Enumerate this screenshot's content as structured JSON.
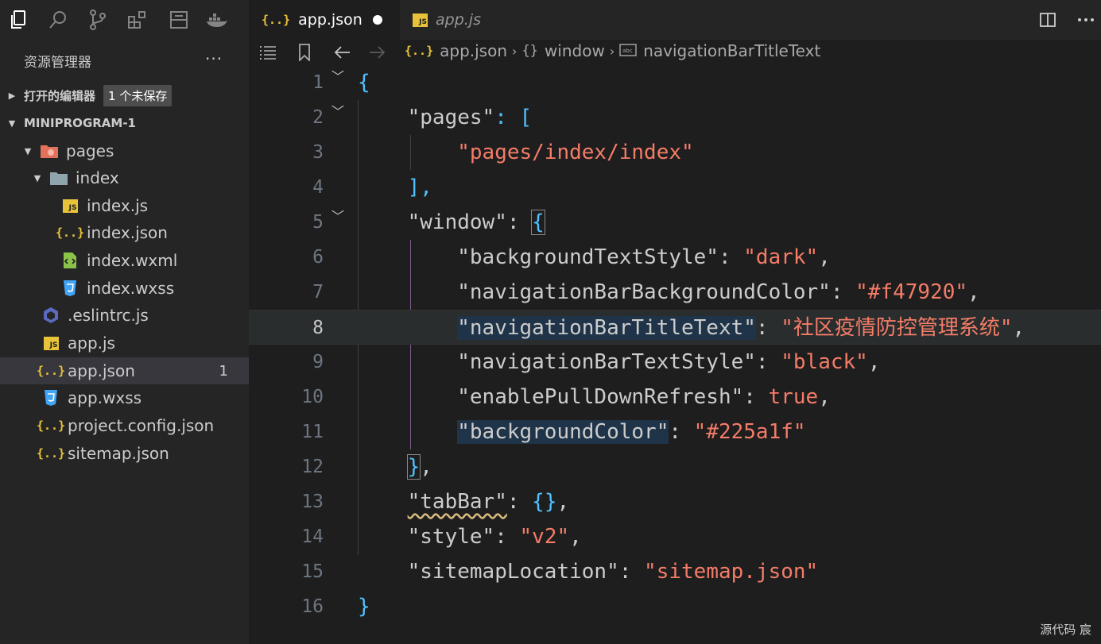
{
  "tabs": [
    {
      "label": "app.json",
      "icon": "json-icon",
      "active": true,
      "unsaved": true
    },
    {
      "label": "app.js",
      "icon": "js-icon",
      "active": false
    }
  ],
  "sidebar": {
    "title": "资源管理器",
    "more": "···",
    "sections": {
      "open_editors": {
        "label": "打开的编辑器",
        "badge": "1 个未保存"
      },
      "project": {
        "label": "MINIPROGRAM-1"
      }
    },
    "tree": [
      {
        "label": "pages",
        "icon": "folder-pages-icon"
      },
      {
        "label": "index",
        "icon": "folder-icon"
      },
      {
        "label": "index.js",
        "icon": "js-icon"
      },
      {
        "label": "index.json",
        "icon": "json-icon"
      },
      {
        "label": "index.wxml",
        "icon": "wxml-icon"
      },
      {
        "label": "index.wxss",
        "icon": "css-icon"
      },
      {
        "label": ".eslintrc.js",
        "icon": "eslint-icon"
      },
      {
        "label": "app.js",
        "icon": "js-icon"
      },
      {
        "label": "app.json",
        "icon": "json-icon",
        "count": "1",
        "selected": true
      },
      {
        "label": "app.wxss",
        "icon": "css-icon"
      },
      {
        "label": "project.config.json",
        "icon": "json-icon"
      },
      {
        "label": "sitemap.json",
        "icon": "json-icon"
      }
    ]
  },
  "breadcrumb": {
    "file": "app.json",
    "obj": "window",
    "prop": "navigationBarTitleText"
  },
  "json_icon_text": "{..}",
  "js_icon_text": "JS",
  "editor": {
    "line_numbers": [
      "1",
      "2",
      "3",
      "4",
      "5",
      "6",
      "7",
      "8",
      "9",
      "10",
      "11",
      "12",
      "13",
      "14",
      "15",
      "16"
    ],
    "lines": {
      "l1": "{",
      "l2_key": "\"pages\"",
      "l2_rest": ": [",
      "l3_val": "\"pages/index/index\"",
      "l4": "],",
      "l5_key": "\"window\"",
      "l5_colon": ": ",
      "l5_brace": "{",
      "l6_key": "\"backgroundTextStyle\"",
      "l6_val": "\"dark\"",
      "l7_key": "\"navigationBarBackgroundColor\"",
      "l7_val": "\"#f47920\"",
      "l8_key": "\"navigationBarTitleText\"",
      "l8_val": "\"社区疫情防控管理系统\"",
      "l9_key": "\"navigationBarTextStyle\"",
      "l9_val": "\"black\"",
      "l10_key": "\"enablePullDownRefresh\"",
      "l10_val": "true",
      "l11_key": "\"backgroundColor\"",
      "l11_val": "\"#225a1f\"",
      "l12_brace": "}",
      "l12_comma": ",",
      "l13_key": "\"tabBar\"",
      "l13_rest": ": ",
      "l13_val": "{}",
      "l14_key": "\"style\"",
      "l14_val": "\"v2\"",
      "l15_key": "\"sitemapLocation\"",
      "l15_val": "\"sitemap.json\"",
      "l16": "}"
    }
  },
  "status": {
    "text": "源代码  宸"
  },
  "colors": {
    "string": "#f47c68",
    "bracket": "#4fc1ff",
    "bg": "#1e1e1e",
    "sidebar": "#252526"
  }
}
